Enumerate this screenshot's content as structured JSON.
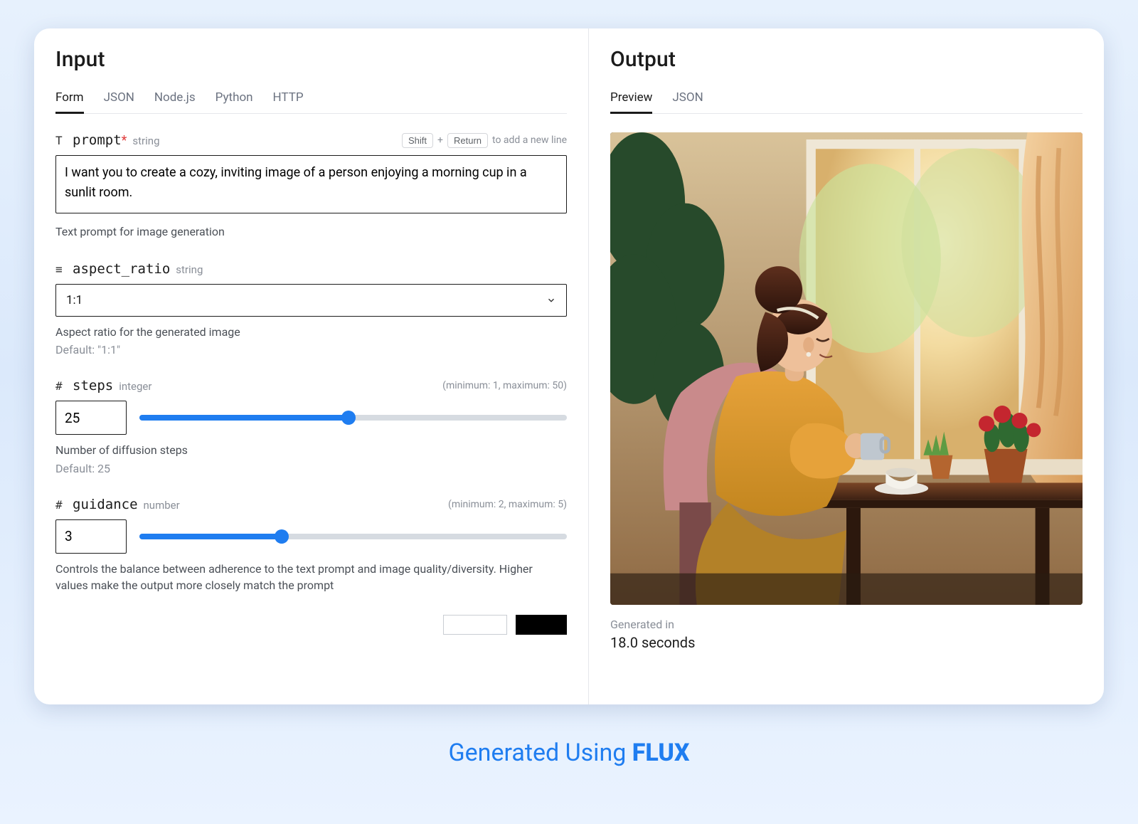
{
  "footer": {
    "prefix": "Generated Using ",
    "brand": "FLUX"
  },
  "input": {
    "title": "Input",
    "tabs": [
      "Form",
      "JSON",
      "Node.js",
      "Python",
      "HTTP"
    ],
    "active_tab": 0,
    "prompt": {
      "icon": "T",
      "label": "prompt",
      "required_mark": "*",
      "type": "string",
      "hint_keys": [
        "Shift",
        "Return"
      ],
      "hint_suffix": "to add a new line",
      "value": "I want you to create a cozy, inviting image of a person enjoying a morning cup in a sunlit room.",
      "description": "Text prompt for image generation"
    },
    "aspect_ratio": {
      "icon": "≡",
      "label": "aspect_ratio",
      "type": "string",
      "value": "1:1",
      "description": "Aspect ratio for the generated image",
      "default_text": "Default: \"1:1\""
    },
    "steps": {
      "icon": "#",
      "label": "steps",
      "type": "integer",
      "range_text": "(minimum: 1, maximum: 50)",
      "value": "25",
      "min": 1,
      "max": 50,
      "description": "Number of diffusion steps",
      "default_text": "Default: 25"
    },
    "guidance": {
      "icon": "#",
      "label": "guidance",
      "type": "number",
      "range_text": "(minimum: 2, maximum: 5)",
      "value": "3",
      "min": 2,
      "max": 5,
      "description": "Controls the balance between adherence to the text prompt and image quality/diversity. Higher values make the output more closely match the prompt"
    }
  },
  "output": {
    "title": "Output",
    "tabs": [
      "Preview",
      "JSON"
    ],
    "active_tab": 0,
    "meta_label": "Generated in",
    "meta_value": "18.0 seconds"
  }
}
